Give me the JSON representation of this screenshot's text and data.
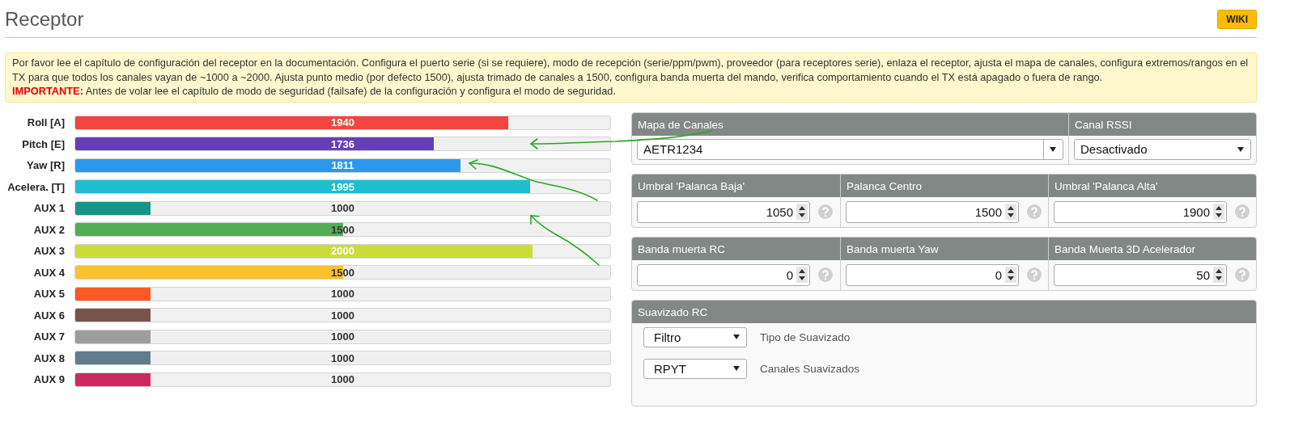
{
  "page": {
    "title": "Receptor",
    "wiki_button": "WIKI"
  },
  "notice": {
    "text": "Por favor lee el capítulo de configuración del receptor en la documentación. Configura el puerto serie (si se requiere), modo de recepción (serie/ppm/pwm), proveedor (para receptores serie), enlaza el receptor, ajusta el mapa de canales, configura extremos/rangos en el TX para que todos los canales vayan de ~1000 a ~2000. Ajusta punto medio (por defecto 1500), ajusta trimado de canales a 1500, configura banda muerta del mando, verifica comportamiento cuando el TX está apagado o fuera de rango.",
    "important": "**IMPORTANTE:** Antes de volar lee el capítulo de modo de seguridad (failsafe) de la configuración y configura el modo de seguridad."
  },
  "channels": [
    {
      "name": "Roll [A]",
      "value": "1940",
      "level": 0.81,
      "color": "#f1453d"
    },
    {
      "name": "Pitch [E]",
      "value": "1736",
      "level": 0.67,
      "color": "#673fb4"
    },
    {
      "name": "Yaw [R]",
      "value": "1811",
      "level": 0.72,
      "color": "#2b98f0"
    },
    {
      "name": "Acelera. [T]",
      "value": "1995",
      "level": 0.85,
      "color": "#1fbcd2"
    },
    {
      "name": "AUX 1",
      "value": "1000",
      "level": 0.14,
      "color": "#159588"
    },
    {
      "name": "AUX 2",
      "value": "1500",
      "level": 0.5,
      "color": "#50ae55"
    },
    {
      "name": "AUX 3",
      "value": "2000",
      "level": 0.855,
      "color": "#cbdc38"
    },
    {
      "name": "AUX 4",
      "value": "1500",
      "level": 0.5,
      "color": "#fdc02f"
    },
    {
      "name": "AUX 5",
      "value": "1000",
      "level": 0.14,
      "color": "#fe5722"
    },
    {
      "name": "AUX 6",
      "value": "1000",
      "level": 0.14,
      "color": "#785549"
    },
    {
      "name": "AUX 7",
      "value": "1000",
      "level": 0.14,
      "color": "#9e9e9e"
    },
    {
      "name": "AUX 8",
      "value": "1000",
      "level": 0.14,
      "color": "#607d8b"
    },
    {
      "name": "AUX 9",
      "value": "1000",
      "level": 0.14,
      "color": "#cd2963"
    }
  ],
  "channel_map": {
    "label": "Mapa de Canales",
    "value": "AETR1234"
  },
  "rssi": {
    "label": "Canal RSSI",
    "value": "Desactivado"
  },
  "stick_fields": [
    {
      "label": "Umbral 'Palanca Baja'",
      "value": "1050"
    },
    {
      "label": "Palanca Centro",
      "value": "1500"
    },
    {
      "label": "Umbral 'Palanca Alta'",
      "value": "1900"
    }
  ],
  "deadband_fields": [
    {
      "label": "Banda muerta RC",
      "value": "0"
    },
    {
      "label": "Banda muerta Yaw",
      "value": "0"
    },
    {
      "label": "Banda Muerta 3D Acelerador",
      "value": "50"
    }
  ],
  "smoothing": {
    "title": "Suavizado RC",
    "rows": [
      {
        "value": "Filtro",
        "label": "Tipo de Suavizado"
      },
      {
        "value": "RPYT",
        "label": "Canales Suavizados"
      }
    ]
  }
}
